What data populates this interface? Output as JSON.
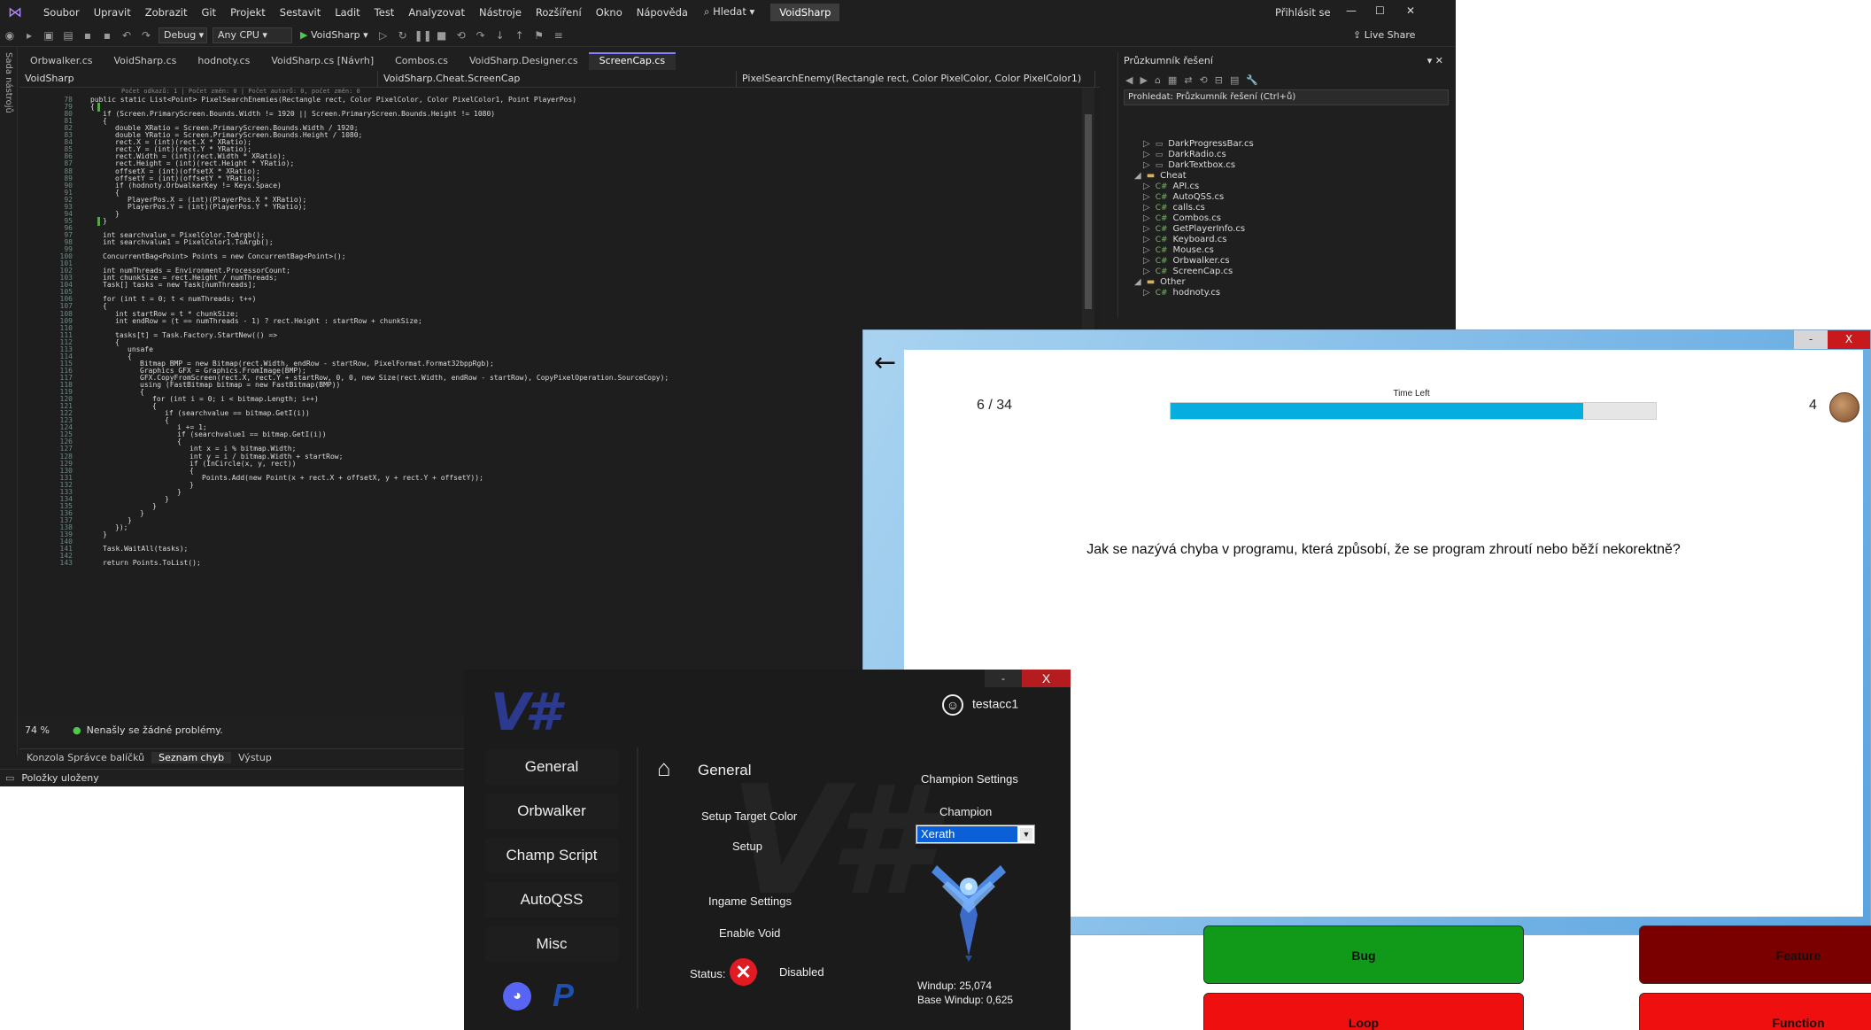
{
  "vs": {
    "menu": [
      "Soubor",
      "Upravit",
      "Zobrazit",
      "Git",
      "Projekt",
      "Sestavit",
      "Ladit",
      "Test",
      "Analyzovat",
      "Nástroje",
      "Rozšíření",
      "Okno",
      "Nápověda"
    ],
    "search": "Hledat",
    "project_name": "VoidSharp",
    "sign_in": "Přihlásit se",
    "live_share": "Live Share",
    "config": "Debug",
    "platform": "Any CPU",
    "run_target": "VoidSharp",
    "side_strip": "Sada nástrojů",
    "tabs": [
      "Orbwalker.cs",
      "VoidSharp.cs",
      "hodnoty.cs",
      "VoidSharp.cs [Návrh]",
      "Combos.cs",
      "VoidSharp.Designer.cs",
      "ScreenCap.cs"
    ],
    "nav": {
      "project": "VoidSharp",
      "class": "VoidSharp.Cheat.ScreenCap",
      "member": "PixelSearchEnemy(Rectangle rect, Color PixelColor, Color PixelColor1)"
    },
    "code_hint": "Počet odkazů: 1 | Počet změn: 0 | Počet autorů: 0, počet změn: 0",
    "code_lines": [
      {
        "n": "78",
        "t": "public static List<Point> PixelSearchEnemies(Rectangle rect, Color PixelColor, Color PixelColor1, Point PlayerPos)",
        "i": 0
      },
      {
        "n": "79",
        "t": "{",
        "i": 0
      },
      {
        "n": "80",
        "t": "if (Screen.PrimaryScreen.Bounds.Width != 1920 || Screen.PrimaryScreen.Bounds.Height != 1080)",
        "i": 1
      },
      {
        "n": "81",
        "t": "{",
        "i": 1
      },
      {
        "n": "82",
        "t": "double XRatio = Screen.PrimaryScreen.Bounds.Width / 1920;",
        "i": 2
      },
      {
        "n": "83",
        "t": "double YRatio = Screen.PrimaryScreen.Bounds.Height / 1080;",
        "i": 2
      },
      {
        "n": "84",
        "t": "rect.X = (int)(rect.X * XRatio);",
        "i": 2
      },
      {
        "n": "85",
        "t": "rect.Y = (int)(rect.Y * YRatio);",
        "i": 2
      },
      {
        "n": "86",
        "t": "rect.Width = (int)(rect.Width * XRatio);",
        "i": 2
      },
      {
        "n": "87",
        "t": "rect.Height = (int)(rect.Height * YRatio);",
        "i": 2
      },
      {
        "n": "88",
        "t": "offsetX = (int)(offsetX * XRatio);",
        "i": 2
      },
      {
        "n": "89",
        "t": "offsetY = (int)(offsetY * YRatio);",
        "i": 2
      },
      {
        "n": "90",
        "t": "if (hodnoty.OrbwalkerKey != Keys.Space)",
        "i": 2
      },
      {
        "n": "91",
        "t": "{",
        "i": 2
      },
      {
        "n": "92",
        "t": "PlayerPos.X = (int)(PlayerPos.X * XRatio);",
        "i": 3
      },
      {
        "n": "93",
        "t": "PlayerPos.Y = (int)(PlayerPos.Y * YRatio);",
        "i": 3
      },
      {
        "n": "94",
        "t": "}",
        "i": 2
      },
      {
        "n": "95",
        "t": "}",
        "i": 1
      },
      {
        "n": "96",
        "t": "",
        "i": 0
      },
      {
        "n": "97",
        "t": "int searchvalue = PixelColor.ToArgb();",
        "i": 1
      },
      {
        "n": "98",
        "t": "int searchvalue1 = PixelColor1.ToArgb();",
        "i": 1
      },
      {
        "n": "99",
        "t": "",
        "i": 0
      },
      {
        "n": "100",
        "t": "ConcurrentBag<Point> Points = new ConcurrentBag<Point>();",
        "i": 1
      },
      {
        "n": "101",
        "t": "",
        "i": 0
      },
      {
        "n": "102",
        "t": "int numThreads = Environment.ProcessorCount;",
        "i": 1
      },
      {
        "n": "103",
        "t": "int chunkSize = rect.Height / numThreads;",
        "i": 1
      },
      {
        "n": "104",
        "t": "Task[] tasks = new Task[numThreads];",
        "i": 1
      },
      {
        "n": "105",
        "t": "",
        "i": 0
      },
      {
        "n": "106",
        "t": "for (int t = 0; t < numThreads; t++)",
        "i": 1
      },
      {
        "n": "107",
        "t": "{",
        "i": 1
      },
      {
        "n": "108",
        "t": "int startRow = t * chunkSize;",
        "i": 2
      },
      {
        "n": "109",
        "t": "int endRow = (t == numThreads - 1) ? rect.Height : startRow + chunkSize;",
        "i": 2
      },
      {
        "n": "110",
        "t": "",
        "i": 0
      },
      {
        "n": "111",
        "t": "tasks[t] = Task.Factory.StartNew(() =>",
        "i": 2
      },
      {
        "n": "112",
        "t": "{",
        "i": 2
      },
      {
        "n": "113",
        "t": "unsafe",
        "i": 3
      },
      {
        "n": "114",
        "t": "{",
        "i": 3
      },
      {
        "n": "115",
        "t": "Bitmap BMP = new Bitmap(rect.Width, endRow - startRow, PixelFormat.Format32bppRgb);",
        "i": 4
      },
      {
        "n": "116",
        "t": "Graphics GFX = Graphics.FromImage(BMP);",
        "i": 4
      },
      {
        "n": "117",
        "t": "GFX.CopyFromScreen(rect.X, rect.Y + startRow, 0, 0, new Size(rect.Width, endRow - startRow), CopyPixelOperation.SourceCopy);",
        "i": 4
      },
      {
        "n": "118",
        "t": "using (FastBitmap bitmap = new FastBitmap(BMP))",
        "i": 4
      },
      {
        "n": "119",
        "t": "{",
        "i": 4
      },
      {
        "n": "120",
        "t": "for (int i = 0; i < bitmap.Length; i++)",
        "i": 5
      },
      {
        "n": "121",
        "t": "{",
        "i": 5
      },
      {
        "n": "122",
        "t": "if (searchvalue == bitmap.GetI(i))",
        "i": 6
      },
      {
        "n": "123",
        "t": "{",
        "i": 6
      },
      {
        "n": "124",
        "t": "i += 1;",
        "i": 7
      },
      {
        "n": "125",
        "t": "if (searchvalue1 == bitmap.GetI(i))",
        "i": 7
      },
      {
        "n": "126",
        "t": "{",
        "i": 7
      },
      {
        "n": "127",
        "t": "int x = i % bitmap.Width;",
        "i": 8
      },
      {
        "n": "128",
        "t": "int y = i / bitmap.Width + startRow;",
        "i": 8
      },
      {
        "n": "129",
        "t": "if (InCircle(x, y, rect))",
        "i": 8
      },
      {
        "n": "130",
        "t": "{",
        "i": 8
      },
      {
        "n": "131",
        "t": "Points.Add(new Point(x + rect.X + offsetX, y + rect.Y + offsetY));",
        "i": 9
      },
      {
        "n": "132",
        "t": "}",
        "i": 8
      },
      {
        "n": "133",
        "t": "}",
        "i": 7
      },
      {
        "n": "134",
        "t": "}",
        "i": 6
      },
      {
        "n": "135",
        "t": "}",
        "i": 5
      },
      {
        "n": "136",
        "t": "}",
        "i": 4
      },
      {
        "n": "137",
        "t": "}",
        "i": 3
      },
      {
        "n": "138",
        "t": "});",
        "i": 2
      },
      {
        "n": "139",
        "t": "}",
        "i": 1
      },
      {
        "n": "140",
        "t": "",
        "i": 0
      },
      {
        "n": "141",
        "t": "Task.WaitAll(tasks);",
        "i": 1
      },
      {
        "n": "142",
        "t": "",
        "i": 0
      },
      {
        "n": "143",
        "t": "return Points.ToList();",
        "i": 1
      }
    ],
    "zoom": "74 %",
    "no_issues": "Nenašly se žádné problémy.",
    "bottom_tabs": [
      "Konzola Správce balíčků",
      "Seznam chyb",
      "Výstup"
    ],
    "status_bar": "Položky uloženy"
  },
  "solution": {
    "title": "Průzkumník řešení",
    "search_placeholder": "Prohledat: Průzkumník řešení (Ctrl+ů)",
    "items": [
      {
        "label": "DarkProgressBar.cs",
        "kind": "file",
        "level": 1
      },
      {
        "label": "DarkRadio.cs",
        "kind": "file",
        "level": 1
      },
      {
        "label": "DarkTextbox.cs",
        "kind": "file",
        "level": 1
      },
      {
        "label": "Cheat",
        "kind": "folder",
        "level": 0
      },
      {
        "label": "API.cs",
        "kind": "cs",
        "level": 1
      },
      {
        "label": "AutoQSS.cs",
        "kind": "cs",
        "level": 1
      },
      {
        "label": "calls.cs",
        "kind": "cs",
        "level": 1
      },
      {
        "label": "Combos.cs",
        "kind": "cs",
        "level": 1
      },
      {
        "label": "GetPlayerInfo.cs",
        "kind": "cs",
        "level": 1
      },
      {
        "label": "Keyboard.cs",
        "kind": "cs",
        "level": 1
      },
      {
        "label": "Mouse.cs",
        "kind": "cs",
        "level": 1
      },
      {
        "label": "Orbwalker.cs",
        "kind": "cs",
        "level": 1
      },
      {
        "label": "ScreenCap.cs",
        "kind": "cs",
        "level": 1
      },
      {
        "label": "Other",
        "kind": "folder",
        "level": 0
      },
      {
        "label": "hodnoty.cs",
        "kind": "cs",
        "level": 1
      }
    ]
  },
  "quiz": {
    "minimize": "-",
    "close": "X",
    "progress_text": "6 / 34",
    "time_left_label": "Time Left",
    "time_left_fraction": 0.85,
    "coins": "4",
    "question": "Jak se nazývá chyba v programu, která způsobí, že se program zhroutí nebo běží nekorektně?",
    "answers": [
      {
        "label": "Bug",
        "color": "#119a1a"
      },
      {
        "label": "Feature",
        "color": "#7a0000"
      },
      {
        "label": "Loop",
        "color": "#ef0f0f"
      },
      {
        "label": "Function",
        "color": "#ef0f0f"
      }
    ]
  },
  "void": {
    "minimize": "-",
    "close": "X",
    "logo": "V#",
    "username": "testacc1",
    "nav": [
      "General",
      "Orbwalker",
      "Champ Script",
      "AutoQSS",
      "Misc"
    ],
    "section_title": "General",
    "setup_target_color": "Setup Target Color",
    "setup": "Setup",
    "ingame_settings": "Ingame Settings",
    "enable_void": "Enable Void",
    "status_label": "Status:",
    "status_value": "Disabled",
    "champion_settings": "Champion Settings",
    "champion_label": "Champion",
    "champion_selected": "Xerath",
    "windup": "Windup: 25,074",
    "base_windup": "Base Windup: 0,625"
  }
}
